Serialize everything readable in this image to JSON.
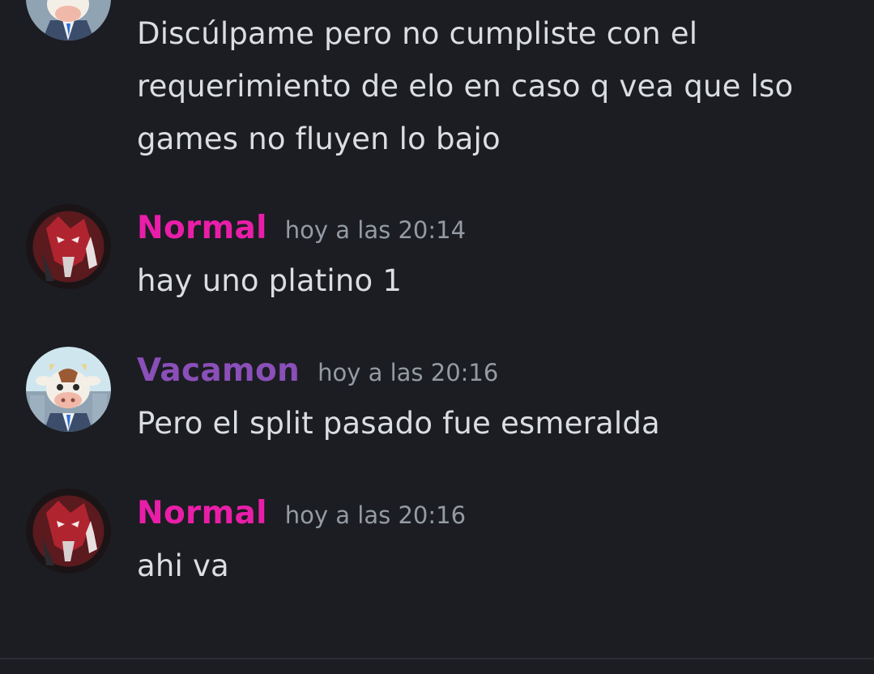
{
  "messages": [
    {
      "author": "",
      "timestamp": "",
      "lines": [
        "Discúlpame pero no cumpliste con el",
        "requerimiento de elo en caso q vea que lso",
        "games no fluyen lo bajo"
      ]
    },
    {
      "author": "Normal",
      "author_color": "#e91ea8",
      "timestamp": "hoy a las 20:14",
      "text": "hay uno platino 1",
      "avatar_icon": "demon-mask-avatar"
    },
    {
      "author": "Vacamon",
      "author_color": "#8a4fb8",
      "timestamp": "hoy a las 20:16",
      "text": "Pero el split pasado fue esmeralda",
      "avatar_icon": "cow-avatar"
    },
    {
      "author": "Normal",
      "author_color": "#e91ea8",
      "timestamp": "hoy a las 20:16",
      "text": "ahi va",
      "avatar_icon": "demon-mask-avatar"
    }
  ]
}
